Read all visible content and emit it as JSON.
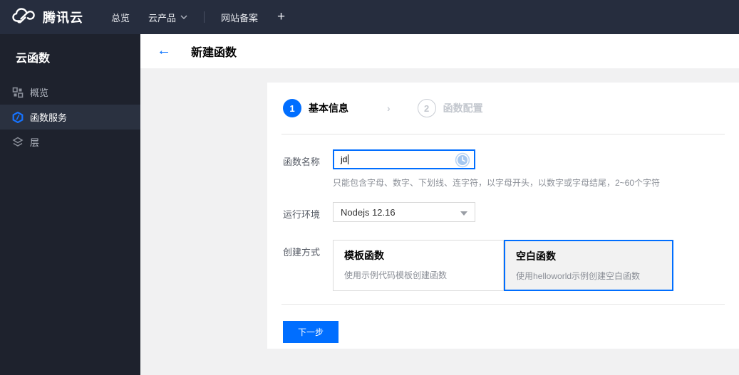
{
  "topbar": {
    "brand": "腾讯云",
    "nav": [
      {
        "label": "总览"
      },
      {
        "label": "云产品"
      },
      {
        "label": "网站备案"
      }
    ],
    "plus": "+"
  },
  "sidebar": {
    "title": "云函数",
    "items": [
      {
        "label": "概览",
        "icon": "grid-icon",
        "selected": false
      },
      {
        "label": "函数服务",
        "icon": "function-service-icon",
        "selected": true
      },
      {
        "label": "层",
        "icon": "layers-icon",
        "selected": false
      }
    ]
  },
  "header": {
    "back": "←",
    "title": "新建函数"
  },
  "wizard": {
    "steps": [
      {
        "num": "1",
        "label": "基本信息",
        "active": true
      },
      {
        "num": "2",
        "label": "函数配置",
        "active": false
      }
    ],
    "step_chevron": "›"
  },
  "form": {
    "name": {
      "label": "函数名称",
      "value": "jd",
      "hint": "只能包含字母、数字、下划线、连字符，以字母开头，以数字或字母结尾，2~60个字符"
    },
    "runtime": {
      "label": "运行环境",
      "value": "Nodejs 12.16"
    },
    "method": {
      "label": "创建方式",
      "options": [
        {
          "title": "模板函数",
          "desc": "使用示例代码模板创建函数",
          "selected": false
        },
        {
          "title": "空白函数",
          "desc": "使用helloworld示例创建空白函数",
          "selected": true
        }
      ]
    }
  },
  "footer": {
    "next_label": "下一步"
  },
  "colors": {
    "accent": "#006eff",
    "topbar_bg": "#262d3e",
    "sidebar_bg": "#1e222d",
    "sidebar_selected_bg": "#2a3140",
    "content_bg": "#f1f1f2",
    "pending_icon_blue": "#a6c8f0"
  }
}
